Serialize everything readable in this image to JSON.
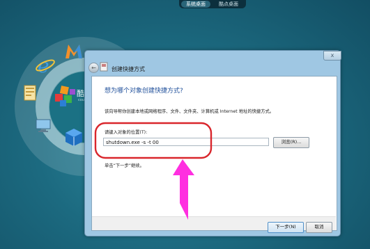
{
  "desktop": {
    "tabs": [
      {
        "label": "系统桌面",
        "active": true
      },
      {
        "label": "酷点桌面",
        "active": false
      }
    ],
    "dial": {
      "center_label": "酷",
      "center_sublabel": "cou",
      "icons": [
        "internet-explorer-icon",
        "maxthon-icon",
        "document-icon",
        "computer-icon",
        "cube-icon",
        "cubes-icon"
      ]
    }
  },
  "dialog": {
    "title": "创建快捷方式",
    "close_label": "x",
    "heading": "想为哪个对象创建快捷方式?",
    "description": "该向导帮你创建本地或网络程序、文件、文件夹、计算机或 Internet 地址的快捷方式。",
    "location_label": "请键入对象的位置(T):",
    "location_value": "shutdown.exe -s -t 00",
    "browse_label": "浏览(R)...",
    "hint": "单击“下一步”继续。",
    "next_label": "下一步(N)",
    "cancel_label": "取消"
  },
  "annotation": {
    "highlight_color": "#d9262c",
    "arrow_color": "#ff2fe0"
  }
}
